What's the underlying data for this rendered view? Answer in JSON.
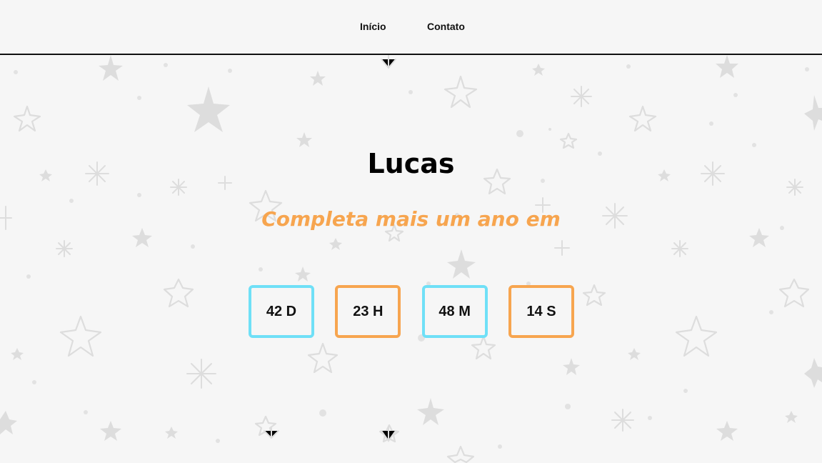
{
  "nav": {
    "links": [
      "Início",
      "Contato"
    ]
  },
  "hero": {
    "name": "Lucas",
    "subtitle": "Completa mais um ano em"
  },
  "countdown": {
    "days": "42 D",
    "hours": "23 H",
    "minutes": "48 M",
    "seconds": "14 S"
  },
  "colors": {
    "background": "#f6f6f6",
    "accent_cyan": "#6fe0f7",
    "accent_orange": "#f7a54f",
    "stars": "#dcdcdc"
  }
}
